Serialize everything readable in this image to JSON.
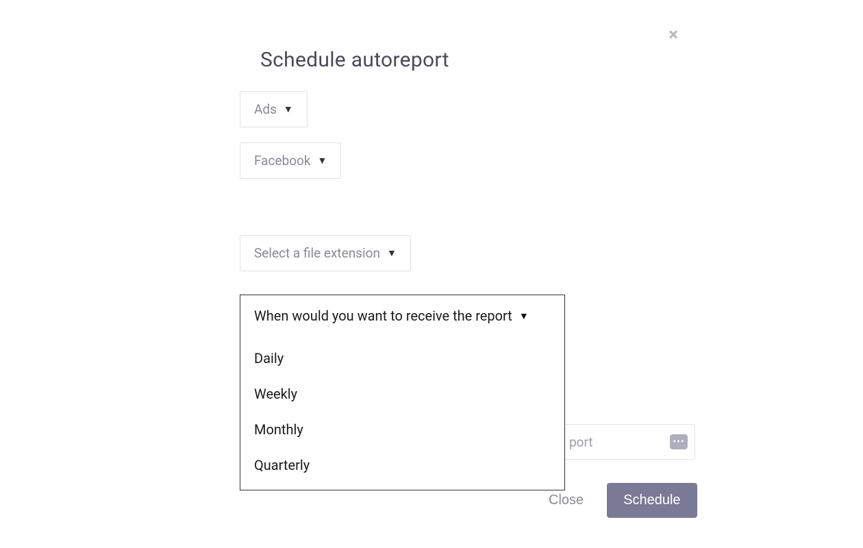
{
  "modal": {
    "title": "Schedule autoreport",
    "close_icon": "×"
  },
  "selects": {
    "category": {
      "value": "Ads"
    },
    "platform": {
      "value": "Facebook"
    },
    "file_ext": {
      "placeholder": "Select a file extension"
    },
    "frequency": {
      "placeholder": "When would you want to receive the report",
      "options": [
        "Daily",
        "Weekly",
        "Monthly",
        "Quarterly"
      ]
    }
  },
  "email_input": {
    "partial_placeholder": "port",
    "ellipsis": "•••"
  },
  "footer": {
    "close": "Close",
    "schedule": "Schedule"
  }
}
